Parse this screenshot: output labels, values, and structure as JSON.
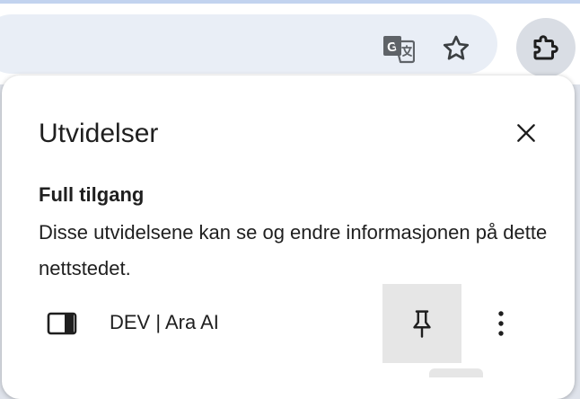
{
  "toolbar": {
    "translate_icon": "translate-icon",
    "bookmark_icon": "bookmark-star-icon",
    "extensions_icon": "puzzle-piece-icon"
  },
  "panel": {
    "title": "Utvidelser",
    "close_icon": "close-icon",
    "section": {
      "heading": "Full tilgang",
      "description": "Disse utvidelsene kan se og endre informasjonen på dette nettstedet."
    },
    "extensions": [
      {
        "name": "DEV | Ara AI",
        "icon": "side-panel-icon",
        "pin_icon": "pin-icon",
        "menu_icon": "more-vert-icon"
      }
    ]
  },
  "colors": {
    "toolbar_bg": "#ffffff",
    "omnibox_bg": "#e9eef6",
    "active_button_bg": "#d9dde4",
    "pin_button_bg": "#e6e6e6",
    "text": "#1f1f1f"
  }
}
